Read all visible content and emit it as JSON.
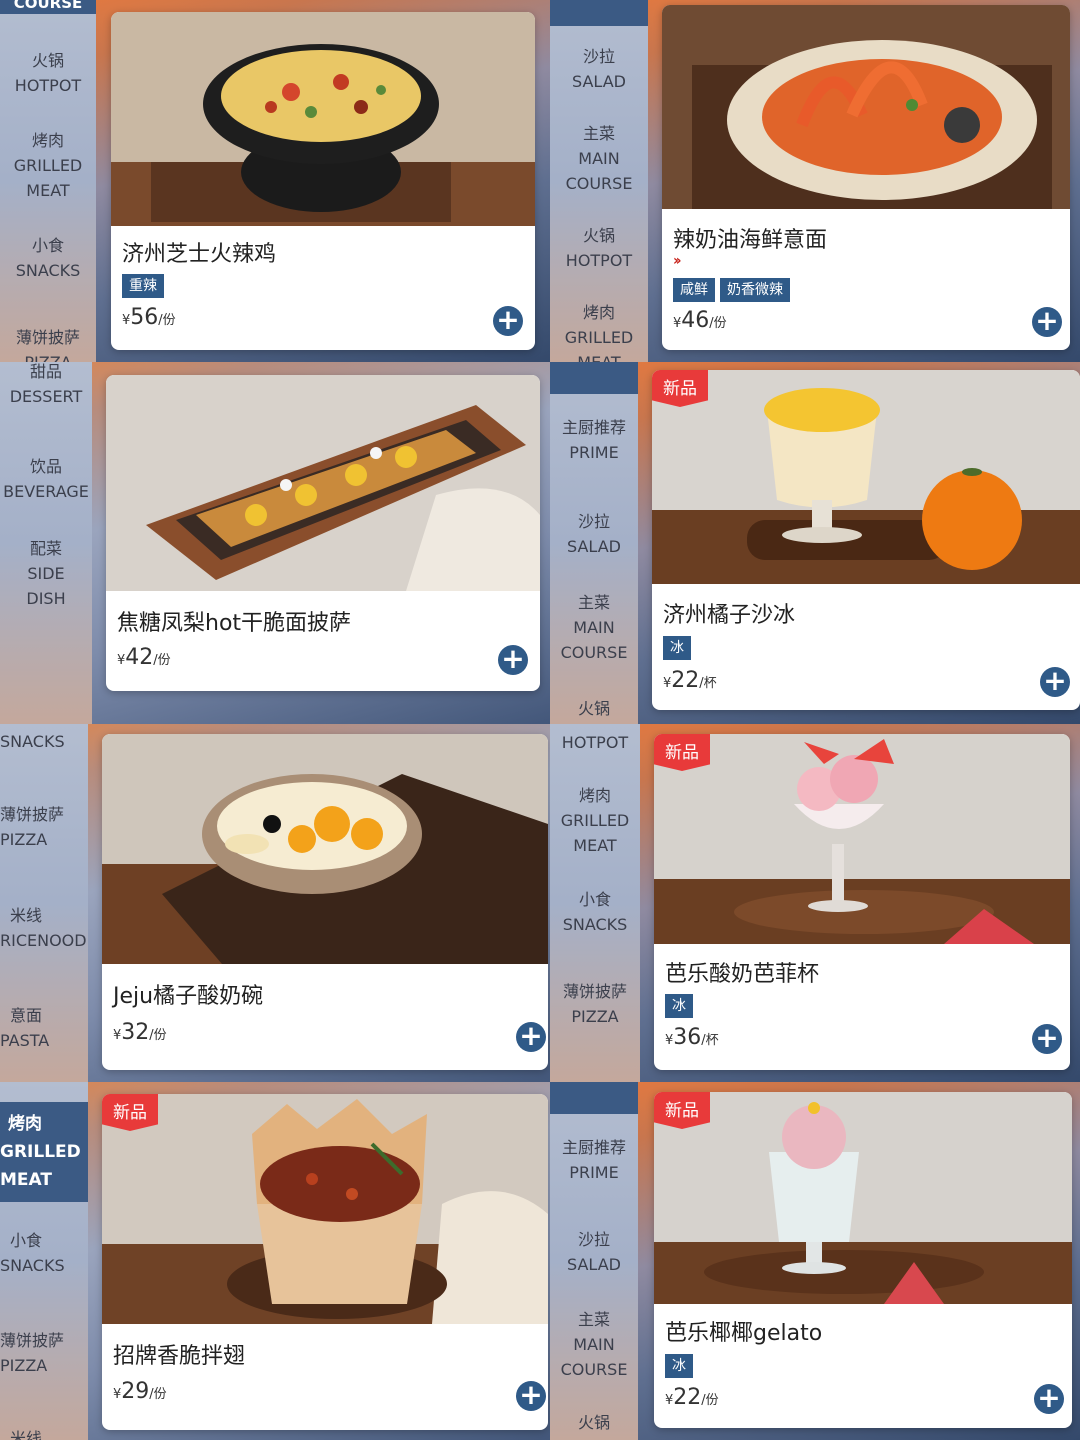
{
  "labels": {
    "course": "COURSE",
    "hotpot_cn": "火锅",
    "hotpot_en": "HOTPOT",
    "grilled_cn": "烤肉",
    "grilled_en1": "GRILLED",
    "grilled_en2": "MEAT",
    "snacks_cn": "小食",
    "snacks_en": "SNACKS",
    "pizza_cn": "薄饼披萨",
    "pizza_en": "PIZZA",
    "salad_cn": "沙拉",
    "salad_en": "SALAD",
    "main_cn": "主菜",
    "main_en1": "MAIN",
    "main_en2": "COURSE",
    "dessert_cn": "甜品",
    "dessert_en": "DESSERT",
    "beverage_cn": "饮品",
    "beverage_en": "BEVERAGE",
    "side_cn": "配菜",
    "side_en1": "SIDE",
    "side_en2": "DISH",
    "prime_cn": "主厨推荐",
    "prime_en": "PRIME",
    "rice_cn": "米线",
    "rice_en": "RICENOOD",
    "pasta_cn": "意面",
    "pasta_en": "PASTA",
    "cut_pizza": "PIZZA",
    "cut_meat": "MEAT",
    "cut_rice": "米线",
    "cut_snack": "小食"
  },
  "cards": [
    {
      "name": "济州芝士火辣鸡",
      "tags": [
        "重辣"
      ],
      "currency": "¥",
      "price": "56",
      "unit": "/份"
    },
    {
      "name": "辣奶油海鲜意面",
      "chili": "››",
      "tags": [
        "咸鲜",
        "奶香微辣"
      ],
      "currency": "¥",
      "price": "46",
      "unit": "/份"
    },
    {
      "name": "焦糖凤梨hot干脆面披萨",
      "currency": "¥",
      "price": "42",
      "unit": "/份"
    },
    {
      "badge": "新品",
      "name": "济州橘子沙冰",
      "tags": [
        "冰"
      ],
      "currency": "¥",
      "price": "22",
      "unit": "/杯"
    },
    {
      "name": "Jeju橘子酸奶碗",
      "currency": "¥",
      "price": "32",
      "unit": "/份"
    },
    {
      "badge": "新品",
      "name": "芭乐酸奶芭菲杯",
      "tags": [
        "冰"
      ],
      "currency": "¥",
      "price": "36",
      "unit": "/杯"
    },
    {
      "badge": "新品",
      "name": "招牌香脆拌翅",
      "currency": "¥",
      "price": "29",
      "unit": "/份"
    },
    {
      "badge": "新品",
      "name": "芭乐椰椰gelato",
      "tags": [
        "冰"
      ],
      "currency": "¥",
      "price": "22",
      "unit": "/份"
    }
  ],
  "add_symbol": "+"
}
